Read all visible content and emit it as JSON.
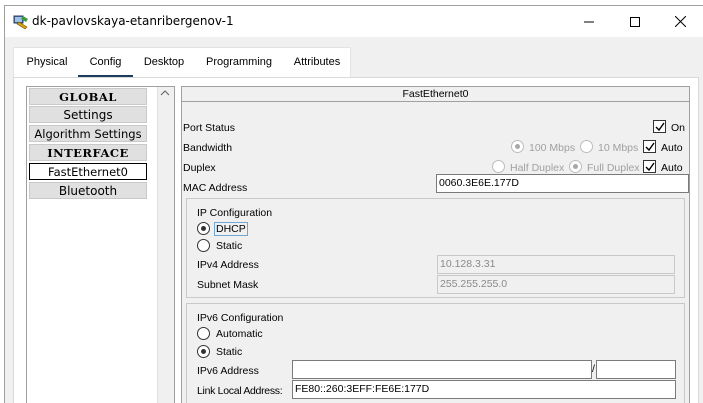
{
  "window": {
    "title": "dk-pavlovskaya-etanribergenov-1"
  },
  "tabs": [
    {
      "label": "Physical"
    },
    {
      "label": "Config"
    },
    {
      "label": "Desktop"
    },
    {
      "label": "Programming"
    },
    {
      "label": "Attributes"
    }
  ],
  "active_tab": "Config",
  "sidebar": {
    "items": [
      {
        "label": "GLOBAL"
      },
      {
        "label": "Settings"
      },
      {
        "label": "Algorithm Settings"
      },
      {
        "label": "INTERFACE"
      },
      {
        "label": "FastEthernet0"
      },
      {
        "label": "Bluetooth"
      }
    ],
    "selected": "FastEthernet0"
  },
  "panel": {
    "title": "FastEthernet0",
    "port_status": {
      "label": "Port Status",
      "on_label": "On",
      "checked": true
    },
    "bandwidth": {
      "label": "Bandwidth",
      "opt1": "100 Mbps",
      "opt2": "10 Mbps",
      "auto_label": "Auto",
      "auto_checked": true
    },
    "duplex": {
      "label": "Duplex",
      "opt1": "Half Duplex",
      "opt2": "Full Duplex",
      "auto_label": "Auto",
      "auto_checked": true
    },
    "mac": {
      "label": "MAC Address",
      "value": "0060.3E6E.177D"
    },
    "ip_config": {
      "title": "IP Configuration",
      "dhcp_label": "DHCP",
      "static_label": "Static",
      "selected": "DHCP",
      "ipv4_label": "IPv4 Address",
      "ipv4_value": "10.128.3.31",
      "mask_label": "Subnet Mask",
      "mask_value": "255.255.255.0"
    },
    "ipv6_config": {
      "title": "IPv6 Configuration",
      "automatic_label": "Automatic",
      "static_label": "Static",
      "selected": "Static",
      "ipv6_label": "IPv6 Address",
      "ipv6_value": "",
      "prefix_sep": "/",
      "prefix_value": "",
      "link_local_label": "Link Local Address:",
      "link_local_value": "FE80::260:3EFF:FE6E:177D"
    }
  }
}
